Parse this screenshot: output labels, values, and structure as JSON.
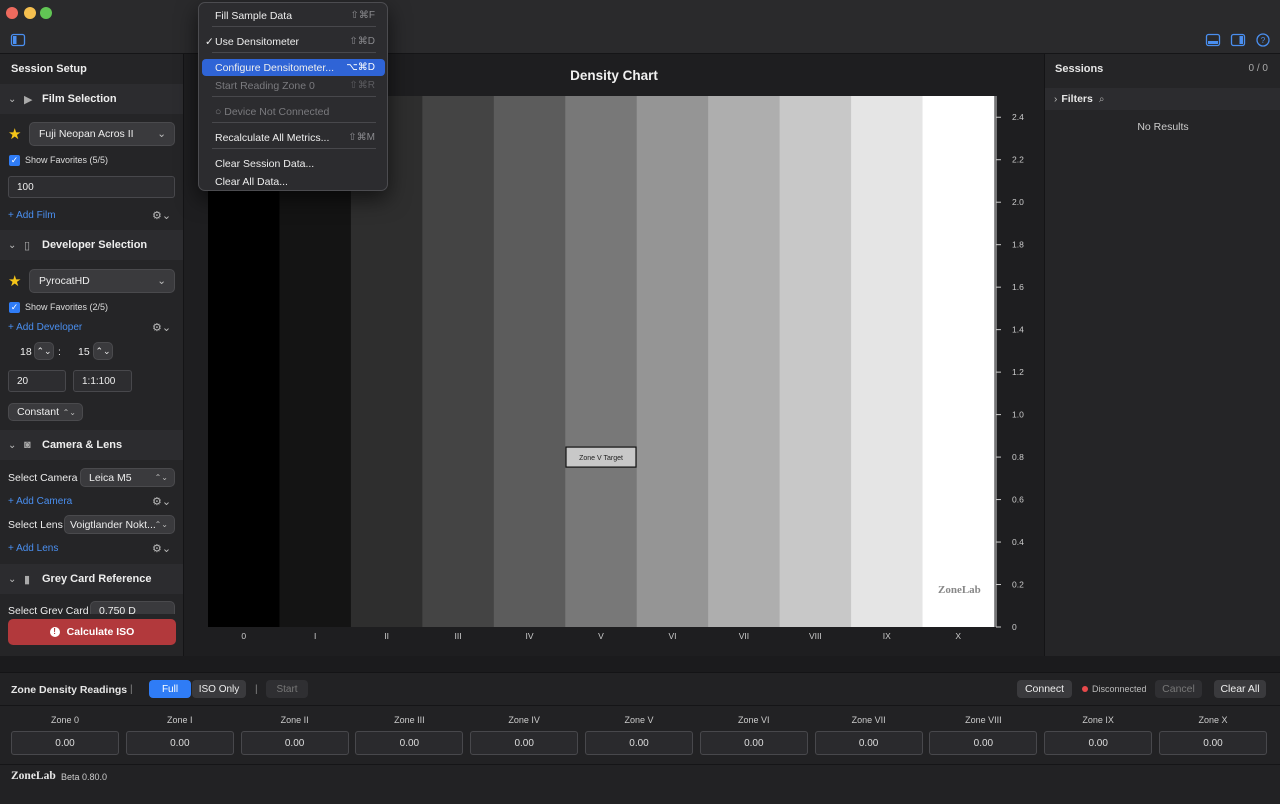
{
  "window": {
    "traffic_colors": [
      "#ed6a5e",
      "#f5bf4f",
      "#61c554"
    ]
  },
  "sidebar": {
    "title": "Session Setup",
    "film": {
      "title": "Film Selection",
      "selected": "Fuji Neopan Acros II",
      "favorites": "Show Favorites (5/5)",
      "iso": "100",
      "add": "+ Add Film"
    },
    "developer": {
      "title": "Developer Selection",
      "selected": "PyrocatHD",
      "favorites": "Show Favorites (2/5)",
      "add": "+ Add Developer",
      "time_min": "18",
      "time_sep": ":",
      "time_sec": "15",
      "temp": "20",
      "dilution": "1:1:100",
      "agitation": "Constant"
    },
    "camera": {
      "title": "Camera & Lens",
      "camera_label": "Select Camera",
      "camera_value": "Leica M5",
      "add_camera": "+ Add Camera",
      "lens_label": "Select Lens",
      "lens_value": "Voigtlander Nokt...",
      "add_lens": "+ Add Lens"
    },
    "grey": {
      "title": "Grey Card Reference",
      "label": "Select Grey Card",
      "value": "0.750 D"
    },
    "calculate": "Calculate ISO"
  },
  "chart": {
    "title": "Density Chart",
    "watermark": "ZoneLab",
    "target_label": "Zone V Target"
  },
  "chart_data": {
    "type": "bar",
    "categories": [
      "0",
      "I",
      "II",
      "III",
      "IV",
      "V",
      "VI",
      "VII",
      "VIII",
      "IX",
      "X"
    ],
    "zone_fills": [
      "#000000",
      "#141414",
      "#2e2e2e",
      "#444444",
      "#5c5c5c",
      "#787878",
      "#959595",
      "#aeaeae",
      "#c8c8c8",
      "#e5e5e5",
      "#ffffff"
    ],
    "y_ticks": [
      "0",
      "0.2",
      "0.4",
      "0.6",
      "0.8",
      "1.0",
      "1.2",
      "1.4",
      "1.6",
      "1.8",
      "2.0",
      "2.2",
      "2.4"
    ],
    "ylim": [
      0,
      2.5
    ],
    "target": {
      "zone": "V",
      "density": 0.8
    }
  },
  "sessions": {
    "title": "Sessions",
    "count": "0 / 0",
    "filters": "Filters",
    "empty": "No Results"
  },
  "readings": {
    "title": "Zone Density Readings",
    "sep": "|",
    "mode_full": "Full",
    "mode_iso": "ISO Only",
    "start": "Start",
    "connect": "Connect",
    "status": "Disconnected",
    "cancel": "Cancel",
    "clear_all": "Clear All",
    "zones": [
      {
        "label": "Zone 0",
        "value": "0.00"
      },
      {
        "label": "Zone I",
        "value": "0.00"
      },
      {
        "label": "Zone II",
        "value": "0.00"
      },
      {
        "label": "Zone III",
        "value": "0.00"
      },
      {
        "label": "Zone IV",
        "value": "0.00"
      },
      {
        "label": "Zone V",
        "value": "0.00"
      },
      {
        "label": "Zone VI",
        "value": "0.00"
      },
      {
        "label": "Zone VII",
        "value": "0.00"
      },
      {
        "label": "Zone VIII",
        "value": "0.00"
      },
      {
        "label": "Zone IX",
        "value": "0.00"
      },
      {
        "label": "Zone X",
        "value": "0.00"
      }
    ]
  },
  "footer": {
    "logo": "ZoneLab",
    "version": "Beta 0.80.0"
  },
  "menu": {
    "items": [
      {
        "label": "Fill Sample Data",
        "shortcut": "⇧⌘F",
        "state": "normal"
      },
      {
        "label": "Use Densitometer",
        "shortcut": "⇧⌘D",
        "state": "checked"
      },
      {
        "label": "Configure Densitometer...",
        "shortcut": "⌥⌘D",
        "state": "selected"
      },
      {
        "label": "Start Reading Zone 0",
        "shortcut": "⇧⌘R",
        "state": "disabled"
      },
      {
        "label": "○ Device Not Connected",
        "shortcut": "",
        "state": "disabled"
      },
      {
        "label": "Recalculate All Metrics...",
        "shortcut": "⇧⌘M",
        "state": "normal"
      },
      {
        "label": "Clear Session Data...",
        "shortcut": "",
        "state": "normal"
      },
      {
        "label": "Clear All Data...",
        "shortcut": "",
        "state": "normal"
      }
    ]
  }
}
